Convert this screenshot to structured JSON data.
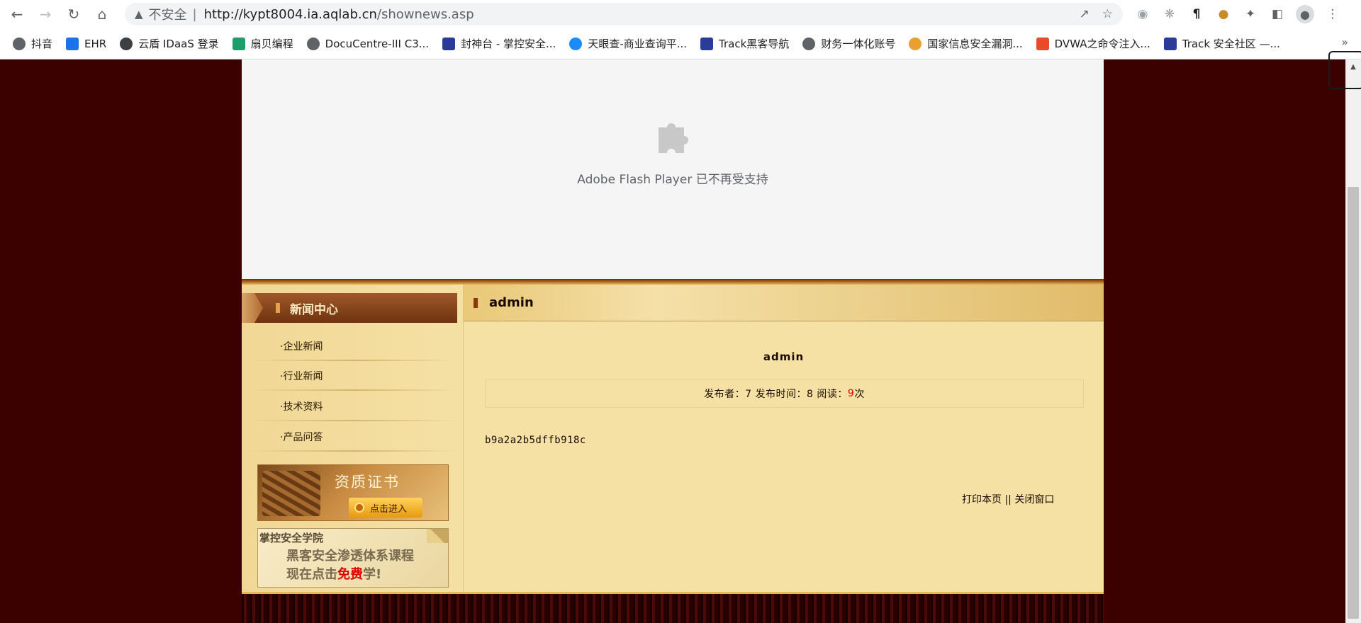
{
  "browser": {
    "security_label": "不安全",
    "separator": "|",
    "url_host": "http://kypt8004.ia.aqlab.cn",
    "url_path": "/shownews.asp"
  },
  "bookmarks": [
    {
      "label": "抖音",
      "icon": "globe-icon"
    },
    {
      "label": "EHR",
      "icon": "ehr-icon"
    },
    {
      "label": "云盾 IDaaS 登录",
      "icon": "shield-icon"
    },
    {
      "label": "扇贝编程",
      "icon": "leaf-icon"
    },
    {
      "label": "DocuCentre-III C3...",
      "icon": "globe-icon"
    },
    {
      "label": "封神台 - 掌控安全...",
      "icon": "shield-icon"
    },
    {
      "label": "天眼查-商业查询平...",
      "icon": "eye-icon"
    },
    {
      "label": "Track黑客导航",
      "icon": "shield-icon"
    },
    {
      "label": "财务一体化账号",
      "icon": "globe-icon"
    },
    {
      "label": "国家信息安全漏洞...",
      "icon": "circle-icon"
    },
    {
      "label": "DVWA之命令注入...",
      "icon": "c-icon"
    },
    {
      "label": "Track 安全社区 —...",
      "icon": "shield-icon"
    }
  ],
  "bookmarks_more": "»",
  "flash": {
    "message": "Adobe Flash Player 已不再受支持"
  },
  "sidebar": {
    "heading": "新闻中心",
    "items": [
      {
        "label": "·企业新闻"
      },
      {
        "label": "·行业新闻"
      },
      {
        "label": "·技术资料"
      },
      {
        "label": "·产品问答"
      }
    ],
    "cert_title": "资质证书",
    "cert_button": "点击进入",
    "academy_title": "掌控安全学院",
    "academy_line1": "黑客安全渗透体系课程",
    "academy_line2_prefix": "现在点击",
    "academy_line2_free": "免费",
    "academy_line2_suffix": "学!"
  },
  "article": {
    "header_title": "admin",
    "title": "admin",
    "meta_prefix": "发布者：7 发布时间：8 阅读：",
    "reads": "9",
    "meta_suffix": "次",
    "body": "b9a2a2b5dffb918c",
    "print_label": "打印本页",
    "divider": "||",
    "close_label": "关闭窗口"
  },
  "colors": {
    "page_bg": "#3b0000",
    "content_bg": "#f5e1a4",
    "accent_red": "#e00000"
  }
}
